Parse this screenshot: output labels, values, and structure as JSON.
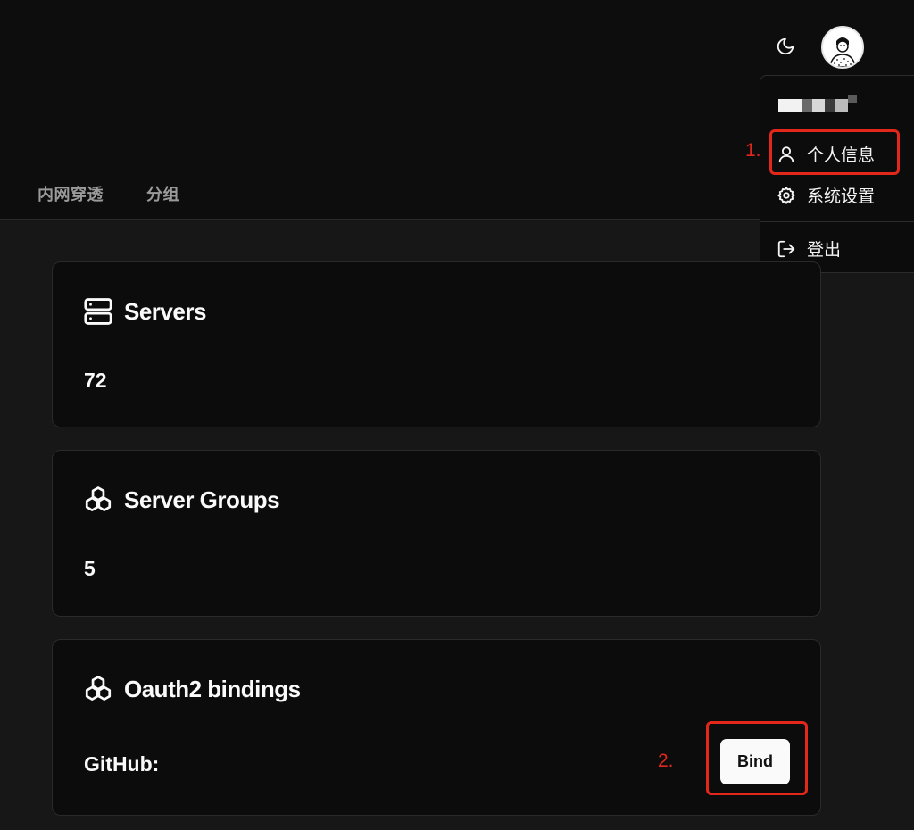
{
  "header": {
    "theme_icon": "moon-icon",
    "avatar_icon": "user-avatar"
  },
  "nav": {
    "tabs": [
      {
        "label": "内网穿透"
      },
      {
        "label": "分组"
      }
    ]
  },
  "user_menu": {
    "items": [
      {
        "label": "个人信息",
        "icon": "user-icon"
      },
      {
        "label": "系统设置",
        "icon": "gear-icon"
      },
      {
        "label": "登出",
        "icon": "logout-icon"
      }
    ]
  },
  "annotations": {
    "step1": "1.",
    "step2": "2.",
    "color": "#e3271b"
  },
  "cards": {
    "servers": {
      "title": "Servers",
      "value": "72",
      "icon": "server-icon"
    },
    "groups": {
      "title": "Server Groups",
      "value": "5",
      "icon": "boxes-icon"
    },
    "oauth": {
      "title": "Oauth2 bindings",
      "provider_label": "GitHub:",
      "bind_label": "Bind",
      "icon": "boxes-icon"
    }
  }
}
